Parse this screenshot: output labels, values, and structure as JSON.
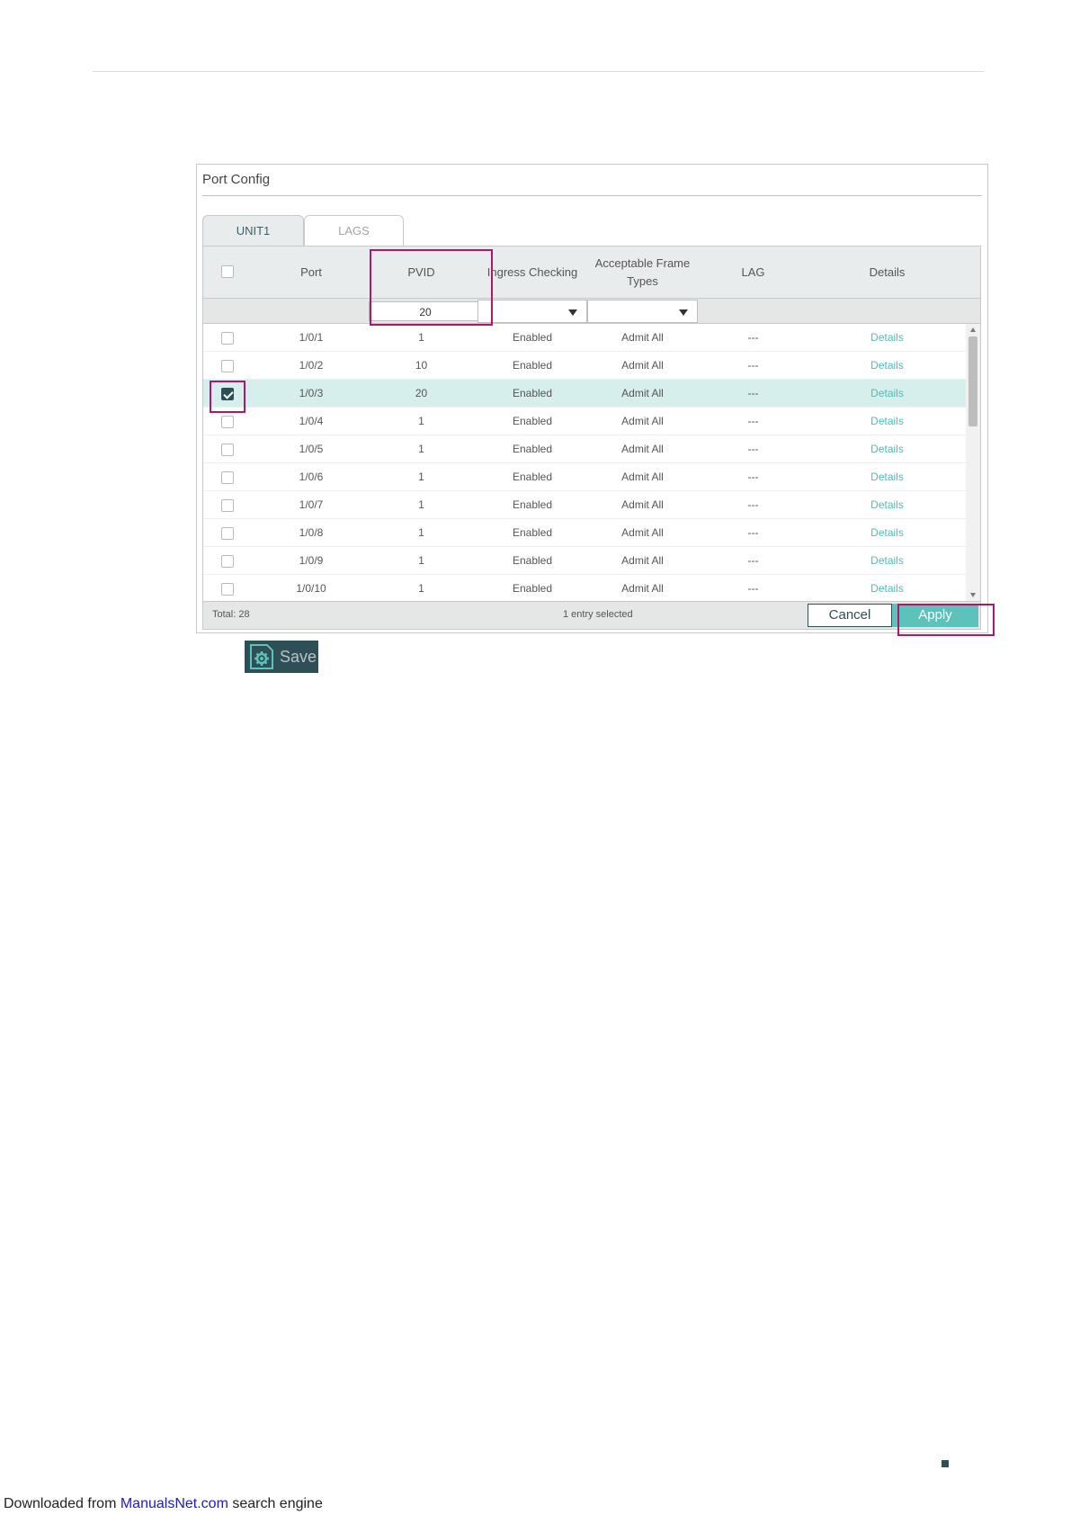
{
  "panel": {
    "title": "Port Config",
    "tabs": [
      {
        "label": "UNIT1",
        "active": true
      },
      {
        "label": "LAGS",
        "active": false
      }
    ]
  },
  "table": {
    "headers": {
      "port": "Port",
      "pvid": "PVID",
      "ingress": "Ingress Checking",
      "acceptable_line1": "Acceptable Frame",
      "acceptable_line2": "Types",
      "lag": "LAG",
      "details": "Details"
    },
    "filter": {
      "pvid_value": "20"
    },
    "rows": [
      {
        "port": "1/0/1",
        "pvid": "1",
        "ingress": "Enabled",
        "frame": "Admit All",
        "lag": "---",
        "details": "Details",
        "checked": false
      },
      {
        "port": "1/0/2",
        "pvid": "10",
        "ingress": "Enabled",
        "frame": "Admit All",
        "lag": "---",
        "details": "Details",
        "checked": false
      },
      {
        "port": "1/0/3",
        "pvid": "20",
        "ingress": "Enabled",
        "frame": "Admit All",
        "lag": "---",
        "details": "Details",
        "checked": true
      },
      {
        "port": "1/0/4",
        "pvid": "1",
        "ingress": "Enabled",
        "frame": "Admit All",
        "lag": "---",
        "details": "Details",
        "checked": false
      },
      {
        "port": "1/0/5",
        "pvid": "1",
        "ingress": "Enabled",
        "frame": "Admit All",
        "lag": "---",
        "details": "Details",
        "checked": false
      },
      {
        "port": "1/0/6",
        "pvid": "1",
        "ingress": "Enabled",
        "frame": "Admit All",
        "lag": "---",
        "details": "Details",
        "checked": false
      },
      {
        "port": "1/0/7",
        "pvid": "1",
        "ingress": "Enabled",
        "frame": "Admit All",
        "lag": "---",
        "details": "Details",
        "checked": false
      },
      {
        "port": "1/0/8",
        "pvid": "1",
        "ingress": "Enabled",
        "frame": "Admit All",
        "lag": "---",
        "details": "Details",
        "checked": false
      },
      {
        "port": "1/0/9",
        "pvid": "1",
        "ingress": "Enabled",
        "frame": "Admit All",
        "lag": "---",
        "details": "Details",
        "checked": false
      },
      {
        "port": "1/0/10",
        "pvid": "1",
        "ingress": "Enabled",
        "frame": "Admit All",
        "lag": "---",
        "details": "Details",
        "checked": false
      }
    ],
    "footer": {
      "total": "Total: 28",
      "selected": "1 entry selected",
      "cancel": "Cancel",
      "apply": "Apply"
    }
  },
  "save": {
    "label": "Save",
    "icon": "gear-icon"
  },
  "footer": {
    "prefix": "Downloaded from ",
    "link": "ManualsNet.com",
    "suffix": " search engine"
  },
  "colors": {
    "accent": "#5bc2bc",
    "dark": "#2f4f57",
    "highlight": "#b0166a",
    "selected_row": "#d6efed",
    "link": "#4fbdb6"
  }
}
